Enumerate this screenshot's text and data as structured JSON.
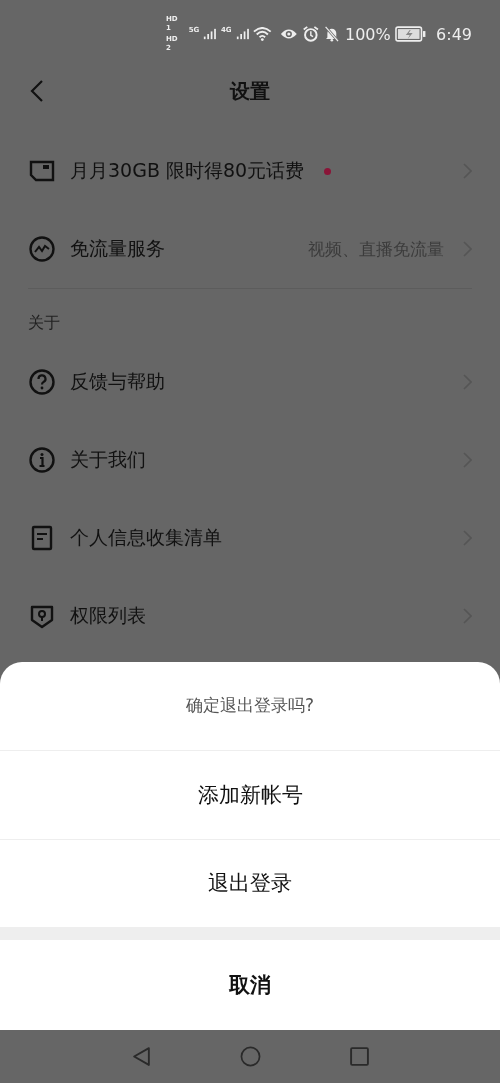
{
  "status_bar": {
    "sim_1": "HD 1",
    "sim_2": "HD 2",
    "network_1": "5G",
    "network_2": "4G",
    "battery": "100%",
    "time": "6:49"
  },
  "header": {
    "title": "设置"
  },
  "items": [
    {
      "kind": "card",
      "label": "月月30GB 限时得80元话费",
      "badge": true
    },
    {
      "kind": "flow",
      "label": "免流量服务",
      "value": "视频、直播免流量",
      "badge": false
    }
  ],
  "section": {
    "title": "关于",
    "items": [
      {
        "kind": "help",
        "label": "反馈与帮助"
      },
      {
        "kind": "info",
        "label": "关于我们"
      },
      {
        "kind": "doc",
        "label": "个人信息收集清单"
      },
      {
        "kind": "shield",
        "label": "权限列表"
      }
    ]
  },
  "sheet": {
    "title": "确定退出登录吗?",
    "options": [
      "添加新帐号",
      "退出登录"
    ],
    "cancel": "取消"
  }
}
